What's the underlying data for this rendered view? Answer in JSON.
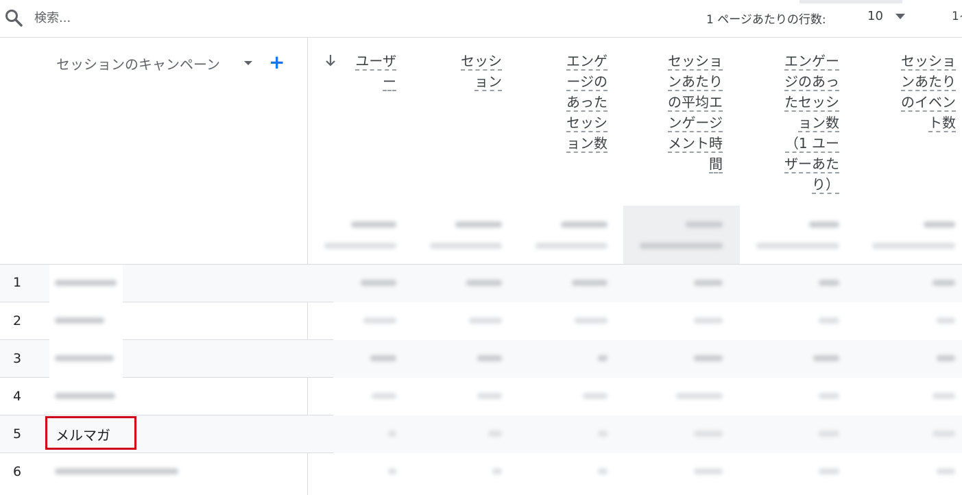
{
  "search": {
    "placeholder": "検索..."
  },
  "pagination": {
    "rows_per_page_label": "1 ページあたりの行数:",
    "rows_per_page_value": "10",
    "page_info": "1~"
  },
  "table": {
    "dimension_header": "セッションのキャンペーン",
    "add_dimension": "+",
    "metric_headers": [
      "ユーザ\nー",
      "セッシ\nョン",
      "エンゲ\nージの\nあった\nセッシ\nョン数",
      "セッショ\nンあたり\nの平均エ\nンゲージ\nメント時\n間",
      "エンゲー\nジのあっ\nたセッシ\nョン数\n（1 ユー\nザーあた\nり）",
      "セッショ\nンあたり\nのイベン\nト数"
    ],
    "rows": [
      {
        "num": "1"
      },
      {
        "num": "2"
      },
      {
        "num": "3"
      },
      {
        "num": "4"
      },
      {
        "num": "5",
        "campaign": "メルマガ"
      },
      {
        "num": "6"
      }
    ]
  },
  "colors": {
    "accent": "#1a73e8",
    "highlight_border": "#d0021b",
    "row_shade": "#f8f9fa"
  }
}
